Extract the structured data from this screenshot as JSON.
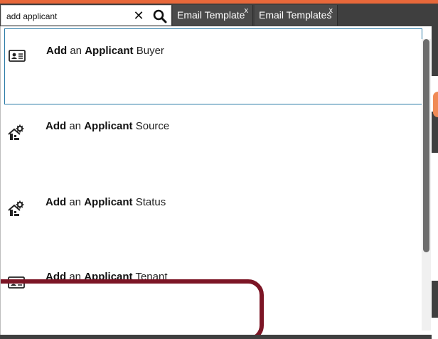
{
  "colors": {
    "accent_top": "#e8683a",
    "highlight_ring": "#7c1525",
    "selected_border": "#2a7aa6",
    "tab_bg": "#4a4a4a"
  },
  "search": {
    "value": "add applicant",
    "clear_icon": "close-icon",
    "search_icon": "magnifier-icon"
  },
  "tabs": [
    {
      "label": "Email Template",
      "close_label": "x"
    },
    {
      "label": "Email Templates",
      "close_label": "x"
    }
  ],
  "results": [
    {
      "verb": "Add",
      "joiner": "an",
      "entity": "Applicant",
      "rest": "Buyer",
      "icon": "contact-card-icon",
      "selected": true
    },
    {
      "verb": "Add",
      "joiner": "an",
      "entity": "Applicant",
      "rest": "Source",
      "icon": "house-gear-icon",
      "selected": false
    },
    {
      "verb": "Add",
      "joiner": "an",
      "entity": "Applicant",
      "rest": "Status",
      "icon": "house-gear-icon",
      "selected": false
    },
    {
      "verb": "Add",
      "joiner": "an",
      "entity": "Applicant",
      "rest": "Tenant",
      "icon": "contact-card-icon",
      "selected": false
    }
  ]
}
